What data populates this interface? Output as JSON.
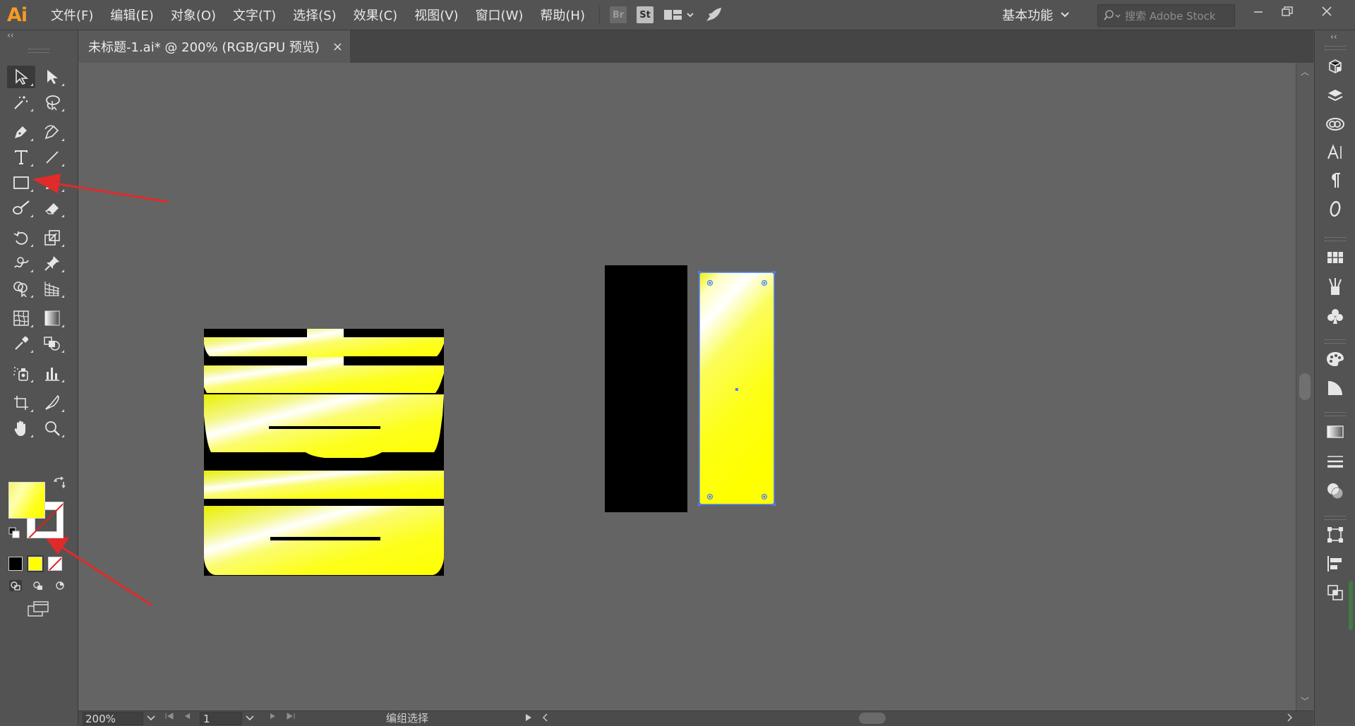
{
  "app": {
    "logo": "Ai",
    "menu": [
      "文件(F)",
      "编辑(E)",
      "对象(O)",
      "文字(T)",
      "选择(S)",
      "效果(C)",
      "视图(V)",
      "窗口(W)",
      "帮助(H)"
    ],
    "bridge_label": "Br",
    "stock_label": "St",
    "workspace_label": "基本功能",
    "search_placeholder": "搜索 Adobe Stock"
  },
  "document": {
    "tab_title": "未标题-1.ai* @ 200% (RGB/GPU 预览)",
    "tab_close": "×"
  },
  "statusbar": {
    "zoom": "200%",
    "page": "1",
    "status": "编组选择"
  },
  "canvas": {
    "glyph": "喜"
  },
  "colors": {
    "fill_gradient_start": "#ffffff",
    "fill_gradient_end": "#ffff00",
    "selection": "#4a7dff",
    "arrow": "#e12a2a",
    "app_bg": "#535353",
    "canvas_bg": "#646464"
  },
  "icons": {
    "tools": [
      "selection-tool",
      "direct-selection-tool",
      "magic-wand-tool",
      "lasso-tool",
      "pen-tool",
      "curvature-tool",
      "type-tool",
      "line-segment-tool",
      "rectangle-tool",
      "paintbrush-tool",
      "blob-brush-tool",
      "eraser-tool",
      "rotate-tool",
      "scale-tool",
      "warp-tool",
      "puppet-warp-tool",
      "shape-builder-tool",
      "perspective-grid-tool",
      "mesh-tool",
      "gradient-tool",
      "eyedropper-tool",
      "blend-tool",
      "symbol-sprayer-tool",
      "column-graph-tool",
      "artboard-tool",
      "slice-tool",
      "hand-tool",
      "zoom-tool"
    ],
    "right_panels": [
      "properties",
      "layers",
      "libraries",
      "character",
      "paragraph",
      "opentype",
      "swatches",
      "brushes",
      "symbols",
      "color",
      "color-guide",
      "gradient",
      "stroke",
      "transparency",
      "transform",
      "align",
      "pathfinder"
    ]
  }
}
